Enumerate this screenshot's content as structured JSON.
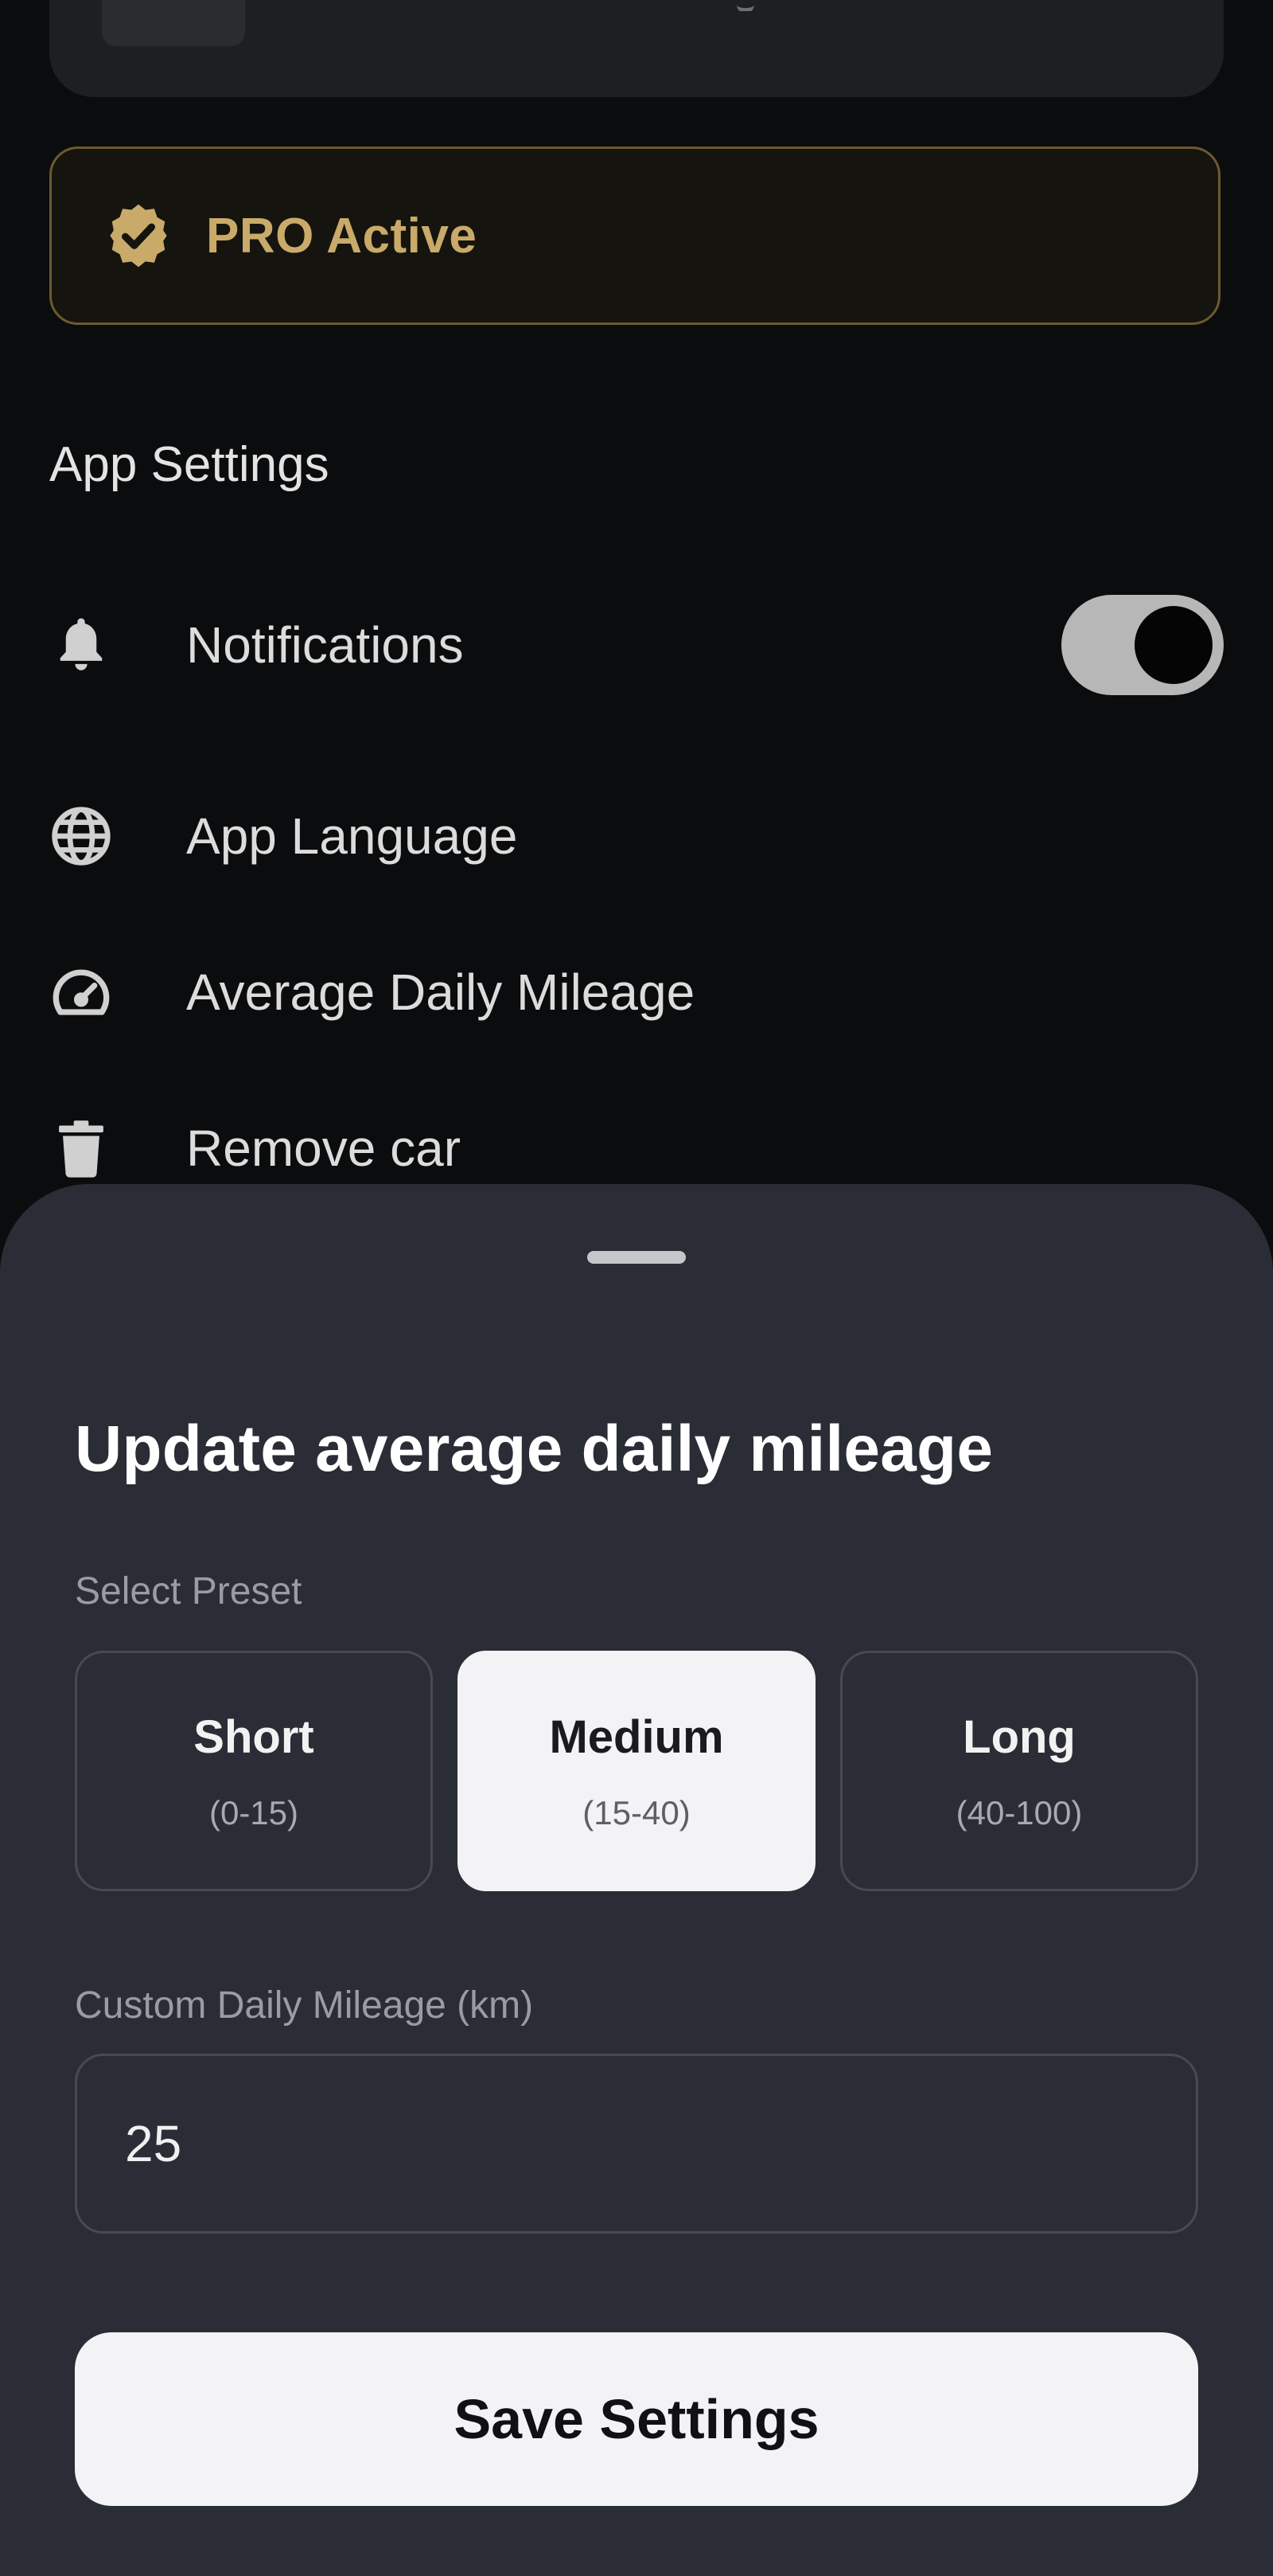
{
  "pro_banner": {
    "label": "PRO Active"
  },
  "app_settings": {
    "title": "App Settings",
    "items": [
      {
        "label": "Notifications",
        "icon": "bell-icon",
        "toggle_on": true
      },
      {
        "label": "App Language",
        "icon": "globe-icon"
      },
      {
        "label": "Average Daily Mileage",
        "icon": "speedometer-icon"
      },
      {
        "label": "Remove car",
        "icon": "trash-icon"
      }
    ]
  },
  "sheet": {
    "title": "Update average daily mileage",
    "preset_label": "Select Preset",
    "presets": [
      {
        "name": "Short",
        "range": "(0-15)",
        "selected": false
      },
      {
        "name": "Medium",
        "range": "(15-40)",
        "selected": true
      },
      {
        "name": "Long",
        "range": "(40-100)",
        "selected": false
      }
    ],
    "custom_label": "Custom Daily Mileage (km)",
    "custom_value": "25",
    "save_label": "Save Settings"
  },
  "colors": {
    "background": "#0b0c0d",
    "pro_gold": "#c9aa69",
    "sheet_bg": "#2a2d35",
    "selected_preset_bg": "#f3f3f6",
    "button_bg": "#f3f3f6"
  }
}
